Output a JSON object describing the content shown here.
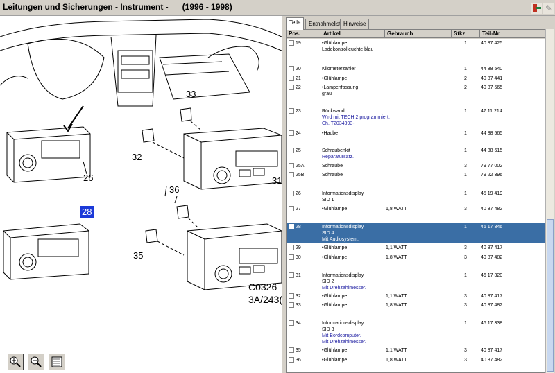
{
  "window": {
    "title": "Leitungen und Sicherungen - Instrument -      (1996 - 1998)",
    "exit_icon": "exit-door-icon",
    "note_icon": "note-icon"
  },
  "drawing": {
    "callouts": [
      "33",
      "32",
      "26",
      "36",
      "35",
      "31",
      "28"
    ],
    "selected_callout": "28",
    "code_line1": "C0326",
    "code_line2": "3A/243("
  },
  "zoom": {
    "in_icon": "zoom-in-icon",
    "out_icon": "zoom-out-icon",
    "fit_icon": "zoom-fit-icon"
  },
  "tabs": [
    {
      "label": "Teile",
      "active": true
    },
    {
      "label": "Entnahmeliste",
      "active": false
    },
    {
      "label": "Hinweise",
      "active": false
    }
  ],
  "table": {
    "headers": [
      "Pos.",
      "Artikel",
      "Gebrauch",
      "Stkz",
      "Teil-Nr."
    ],
    "rows": [
      {
        "pos": "19",
        "art": "•Glühlampe",
        "sub": "Ladekontrolleuchte  blau",
        "note": "",
        "geb": "",
        "st": "1",
        "tn": "40 87 425"
      },
      {
        "pos": "20",
        "art": "Kilometerzähler",
        "sub": "",
        "note": "",
        "geb": "",
        "st": "1",
        "tn": "44 88 540"
      },
      {
        "pos": "21",
        "art": "•Glühlampe",
        "sub": "",
        "note": "",
        "geb": "",
        "st": "2",
        "tn": "40 87 441"
      },
      {
        "pos": "22",
        "art": "•Lampenfassung",
        "sub": "grau",
        "note": "",
        "geb": "",
        "st": "2",
        "tn": "40 87 565"
      },
      {
        "pos": "23",
        "art": "Rückwand",
        "sub": "",
        "note": "Wird mit TECH 2 programmiert.\nCh. T2034393-",
        "geb": "",
        "st": "1",
        "tn": "47 11 214"
      },
      {
        "pos": "24",
        "art": "•Haube",
        "sub": "",
        "note": "",
        "geb": "",
        "st": "1",
        "tn": "44 88 565"
      },
      {
        "pos": "25",
        "art": "Schraubenkit",
        "sub": "",
        "note": "Reparatursatz.",
        "geb": "",
        "st": "1",
        "tn": "44 88 615"
      },
      {
        "pos": "25A",
        "art": "Schraube",
        "sub": "",
        "note": "",
        "geb": "",
        "st": "3",
        "tn": "79 77 002"
      },
      {
        "pos": "25B",
        "art": "Schraube",
        "sub": "",
        "note": "",
        "geb": "",
        "st": "1",
        "tn": "79 22 396"
      },
      {
        "pos": "26",
        "art": "Informationsdisplay",
        "sub": "SID 1",
        "note": "",
        "geb": "",
        "st": "1",
        "tn": "45 19 419"
      },
      {
        "pos": "27",
        "art": "•Glühlampe",
        "sub": "",
        "note": "",
        "geb": "1,8 WATT",
        "st": "3",
        "tn": "40 87 482"
      },
      {
        "pos": "28",
        "art": "Informationsdisplay",
        "sub": "SID 4",
        "note": "Mit Audiosystem.",
        "geb": "",
        "st": "1",
        "tn": "46 17 346"
      },
      {
        "pos": "29",
        "art": "•Glühlampe",
        "sub": "",
        "note": "",
        "geb": "1,1 WATT",
        "st": "3",
        "tn": "40 87 417"
      },
      {
        "pos": "30",
        "art": "•Glühlampe",
        "sub": "",
        "note": "",
        "geb": "1,8 WATT",
        "st": "3",
        "tn": "40 87 482"
      },
      {
        "pos": "31",
        "art": "Informationsdisplay",
        "sub": "SID 2",
        "note": "Mit Drehzahlmesser.",
        "geb": "",
        "st": "1",
        "tn": "46 17 320"
      },
      {
        "pos": "32",
        "art": "•Glühlampe",
        "sub": "",
        "note": "",
        "geb": "1,1 WATT",
        "st": "3",
        "tn": "40 87 417"
      },
      {
        "pos": "33",
        "art": "•Glühlampe",
        "sub": "",
        "note": "",
        "geb": "1,8 WATT",
        "st": "3",
        "tn": "40 87 482"
      },
      {
        "pos": "34",
        "art": "Informationsdisplay",
        "sub": "SID 3",
        "note": "Mit Bordcomputer.\nMit Drehzahlmesser.",
        "geb": "",
        "st": "1",
        "tn": "46 17 338"
      },
      {
        "pos": "35",
        "art": "•Glühlampe",
        "sub": "",
        "note": "",
        "geb": "1,1 WATT",
        "st": "3",
        "tn": "40 87 417"
      },
      {
        "pos": "36",
        "art": "•Glühlampe",
        "sub": "",
        "note": "",
        "geb": "1,8 WATT",
        "st": "3",
        "tn": "40 87 482"
      }
    ],
    "selected_pos": "28"
  }
}
